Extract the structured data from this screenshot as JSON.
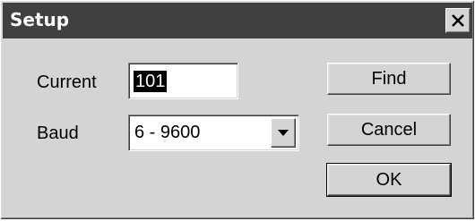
{
  "window": {
    "title": "Setup"
  },
  "form": {
    "current_label": "Current",
    "current_value": "101",
    "baud_label": "Baud",
    "baud_value": "6 - 9600"
  },
  "buttons": {
    "find": "Find",
    "cancel": "Cancel",
    "ok": "OK"
  },
  "icons": {
    "close": "close-icon",
    "dropdown": "chevron-down-icon"
  },
  "colors": {
    "titlebar": "#404040",
    "window_bg": "#d4d4d4",
    "selection_bg": "#000000"
  }
}
